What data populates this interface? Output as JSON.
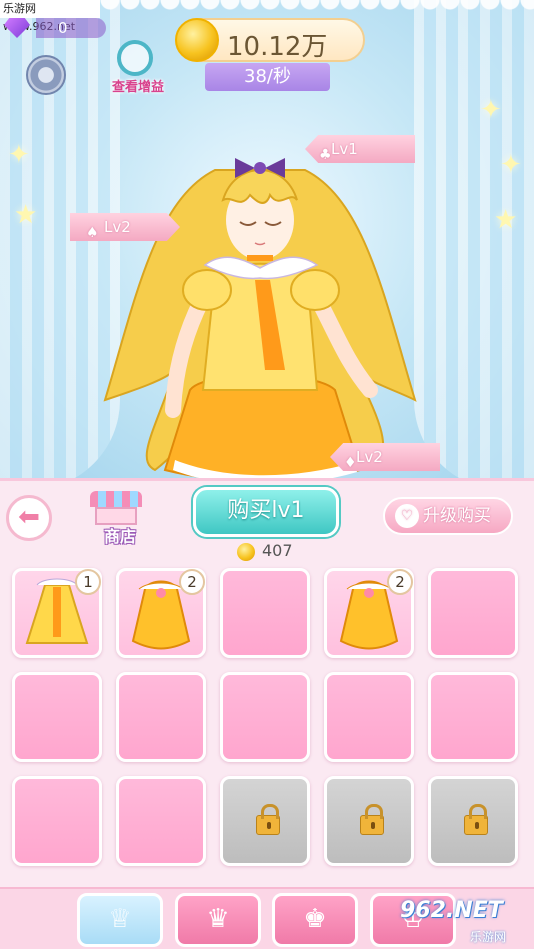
{
  "watermark": {
    "top": "乐游网 www.962.net",
    "bottom_main": "962.NET",
    "bottom_sub": "乐游网"
  },
  "header": {
    "gems": "0",
    "coins_total": "10.12万",
    "coins_rate": "38/秒",
    "boost_label": "查看增益"
  },
  "stage": {
    "tags": [
      {
        "label": "Lv1",
        "icon": "top-icon"
      },
      {
        "label": "Lv2",
        "icon": "hair-icon"
      },
      {
        "label": "Lv2",
        "icon": "skirt-icon"
      }
    ]
  },
  "shop": {
    "store_label": "商店",
    "buy_label": "购买lv1",
    "upgrade_label": "升级购买",
    "price": "407",
    "slots": [
      {
        "state": "filled",
        "badge": "1",
        "item": "yellow-dress"
      },
      {
        "state": "filled",
        "badge": "2",
        "item": "yellow-gown"
      },
      {
        "state": "empty",
        "badge": ""
      },
      {
        "state": "filled",
        "badge": "2",
        "item": "yellow-gown"
      },
      {
        "state": "empty",
        "badge": ""
      },
      {
        "state": "empty",
        "badge": ""
      },
      {
        "state": "empty",
        "badge": ""
      },
      {
        "state": "empty",
        "badge": ""
      },
      {
        "state": "empty",
        "badge": ""
      },
      {
        "state": "empty",
        "badge": ""
      },
      {
        "state": "empty",
        "badge": ""
      },
      {
        "state": "empty",
        "badge": ""
      },
      {
        "state": "locked",
        "badge": ""
      },
      {
        "state": "locked",
        "badge": ""
      },
      {
        "state": "locked",
        "badge": ""
      }
    ]
  },
  "tabs": [
    {
      "name": "dress-tab",
      "icon": "dress-icon",
      "active": true
    },
    {
      "name": "hair-tab",
      "icon": "hair-icon",
      "active": false
    },
    {
      "name": "accessory-tab",
      "icon": "accessory-icon",
      "active": false
    },
    {
      "name": "more-tab",
      "icon": "more-icon",
      "active": false
    }
  ],
  "colors": {
    "accent_pink": "#ffa6ce",
    "buy_teal": "#3fc7c3",
    "coin_gold": "#f7c31f",
    "rate_purple": "#a885e6"
  }
}
